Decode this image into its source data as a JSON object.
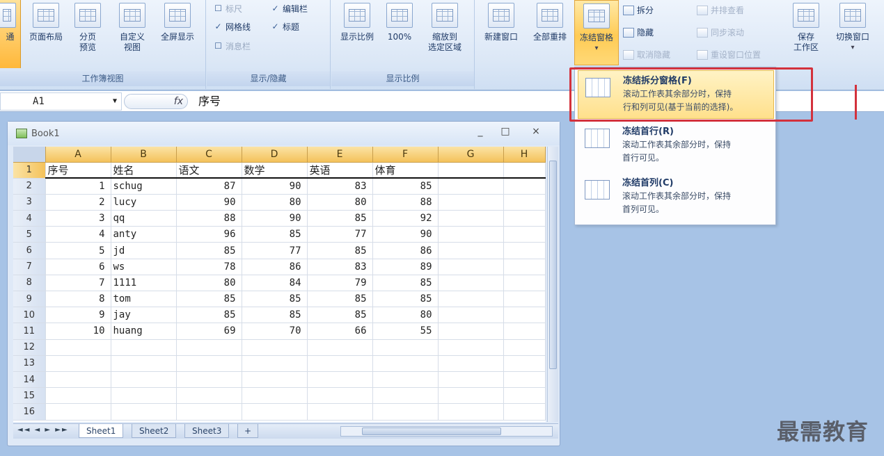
{
  "ribbon": {
    "workbook_views": {
      "group_label": "工作簿视图",
      "normal": "通",
      "page_layout": "页面布局",
      "page_break": "分页\n预览",
      "custom_views": "自定义\n视图",
      "full_screen": "全屏显示"
    },
    "show_hide": {
      "group_label": "显示/隐藏",
      "ruler": "标尺",
      "gridlines": "网格线",
      "message_bar": "消息栏",
      "formula_bar": "编辑栏",
      "headings": "标题"
    },
    "zoom": {
      "group_label": "显示比例",
      "zoom": "显示比例",
      "hundred": "100%",
      "zoom_selection": "缩放到\n选定区域"
    },
    "window": {
      "new_window": "新建窗口",
      "arrange_all": "全部重排",
      "freeze_panes": "冻结窗格",
      "split": "拆分",
      "hide": "隐藏",
      "unhide": "取消隐藏",
      "view_side_by_side": "并排查看",
      "sync_scrolling": "同步滚动",
      "reset_position": "重设窗口位置",
      "save_workspace": "保存\n工作区",
      "switch_windows": "切换窗口"
    }
  },
  "formula_bar": {
    "name_box": "A1",
    "fx": "fx",
    "content": "序号"
  },
  "workbook": {
    "title": "Book1",
    "min": "_",
    "max": "□",
    "close": "×",
    "columns": [
      "A",
      "B",
      "C",
      "D",
      "E",
      "F",
      "G",
      "H"
    ],
    "header_row": [
      "序号",
      "姓名",
      "语文",
      "数学",
      "英语",
      "体育"
    ],
    "rows": [
      {
        "n": "2",
        "a": "1",
        "b": "schug",
        "c": "87",
        "d": "90",
        "e": "83",
        "f": "85"
      },
      {
        "n": "3",
        "a": "2",
        "b": "lucy",
        "c": "90",
        "d": "80",
        "e": "80",
        "f": "88"
      },
      {
        "n": "4",
        "a": "3",
        "b": "qq",
        "c": "88",
        "d": "90",
        "e": "85",
        "f": "92"
      },
      {
        "n": "5",
        "a": "4",
        "b": "anty",
        "c": "96",
        "d": "85",
        "e": "77",
        "f": "90"
      },
      {
        "n": "6",
        "a": "5",
        "b": "jd",
        "c": "85",
        "d": "77",
        "e": "85",
        "f": "86"
      },
      {
        "n": "7",
        "a": "6",
        "b": "ws",
        "c": "78",
        "d": "86",
        "e": "83",
        "f": "89"
      },
      {
        "n": "8",
        "a": "7",
        "b": "1111",
        "c": "80",
        "d": "84",
        "e": "79",
        "f": "85"
      },
      {
        "n": "9",
        "a": "8",
        "b": "tom",
        "c": "85",
        "d": "85",
        "e": "85",
        "f": "85"
      },
      {
        "n": "10",
        "a": "9",
        "b": "jay",
        "c": "85",
        "d": "85",
        "e": "85",
        "f": "80"
      },
      {
        "n": "11",
        "a": "10",
        "b": "huang",
        "c": "69",
        "d": "70",
        "e": "66",
        "f": "55"
      }
    ],
    "empty_rows": [
      "12",
      "13",
      "14",
      "15",
      "16"
    ],
    "tab_nav": "◄◄ ◄ ► ►►",
    "tabs": [
      "Sheet1",
      "Sheet2",
      "Sheet3"
    ]
  },
  "freeze_menu": {
    "items": [
      {
        "title": "冻结拆分窗格(F)",
        "desc1": "滚动工作表其余部分时，保持",
        "desc2": "行和列可见(基于当前的选择)。"
      },
      {
        "title": "冻结首行(R)",
        "desc1": "滚动工作表其余部分时，保持",
        "desc2": "首行可见。"
      },
      {
        "title": "冻结首列(C)",
        "desc1": "滚动工作表其余部分时，保持",
        "desc2": "首列可见。"
      }
    ]
  },
  "watermark": "最需教育",
  "colors": {
    "accent": "#f4c25b",
    "highlight_box": "#d3313c",
    "background": "#a7c3e6"
  }
}
